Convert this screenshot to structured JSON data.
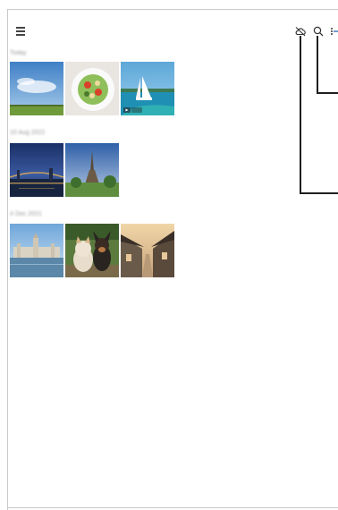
{
  "toolbar": {
    "menu_icon": "hamburger-menu-icon",
    "cloud_icon": "cloud-off-icon",
    "search_icon": "search-icon",
    "more_icon": "more-options-icon"
  },
  "groups": [
    {
      "date": "Today",
      "items": [
        "sky-over-field",
        "salad-bowl",
        "sailboat-video"
      ]
    },
    {
      "date": "10 Aug 2022",
      "items": [
        "city-bridge-dusk",
        "eiffel-tower"
      ]
    },
    {
      "date": "4 Dec 2021",
      "items": [
        "river-city-skyline",
        "cat-and-dog",
        "village-street"
      ]
    }
  ],
  "colors": {
    "callout": "#1f1f1f",
    "accent": "#2b6cb0"
  }
}
